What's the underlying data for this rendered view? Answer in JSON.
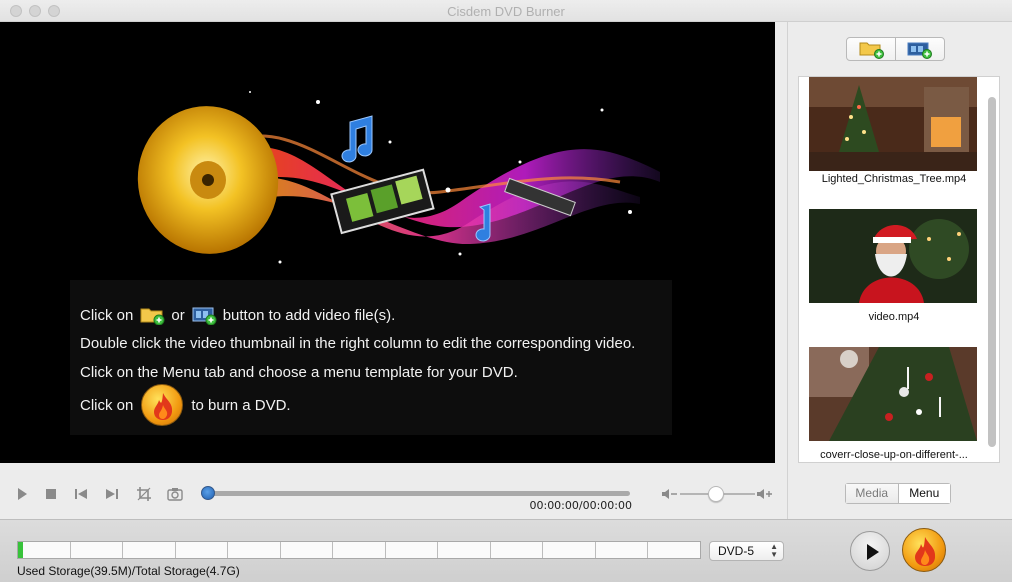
{
  "window": {
    "title": "Cisdem DVD Burner"
  },
  "preview": {
    "line1_a": "Click on",
    "line1_b": "or",
    "line1_c": "button to add video file(s).",
    "line2": "Double click the video thumbnail in the right column to edit the corresponding video.",
    "line3": "Click on the Menu tab and choose a menu template for your DVD.",
    "line4_a": "Click on",
    "line4_b": "to burn a DVD."
  },
  "controls": {
    "timecode": "00:00:00/00:00:00",
    "progress": 0,
    "volume": 0.5
  },
  "media": {
    "items": [
      {
        "label": "Lighted_Christmas_Tree.mp4",
        "thumb": "christmas-tree-room"
      },
      {
        "label": "video.mp4",
        "thumb": "santa-claus"
      },
      {
        "label": "coverr-close-up-on-different-...",
        "thumb": "tree-ornaments-closeup"
      }
    ]
  },
  "tabs": {
    "media": "Media",
    "menu": "Menu",
    "selected": "Menu"
  },
  "storage": {
    "text": "Used Storage(39.5M)/Total Storage(4.7G)",
    "used_fraction": 0.008,
    "disc_type": "DVD-5"
  },
  "icons": {
    "add_folder": "folder-add-icon",
    "add_video": "film-add-icon",
    "burn": "flame-icon",
    "play": "play-icon"
  },
  "colors": {
    "storage_fill": "#37c23a",
    "burn": "#f29a10",
    "accent": "#1f5fb0"
  }
}
